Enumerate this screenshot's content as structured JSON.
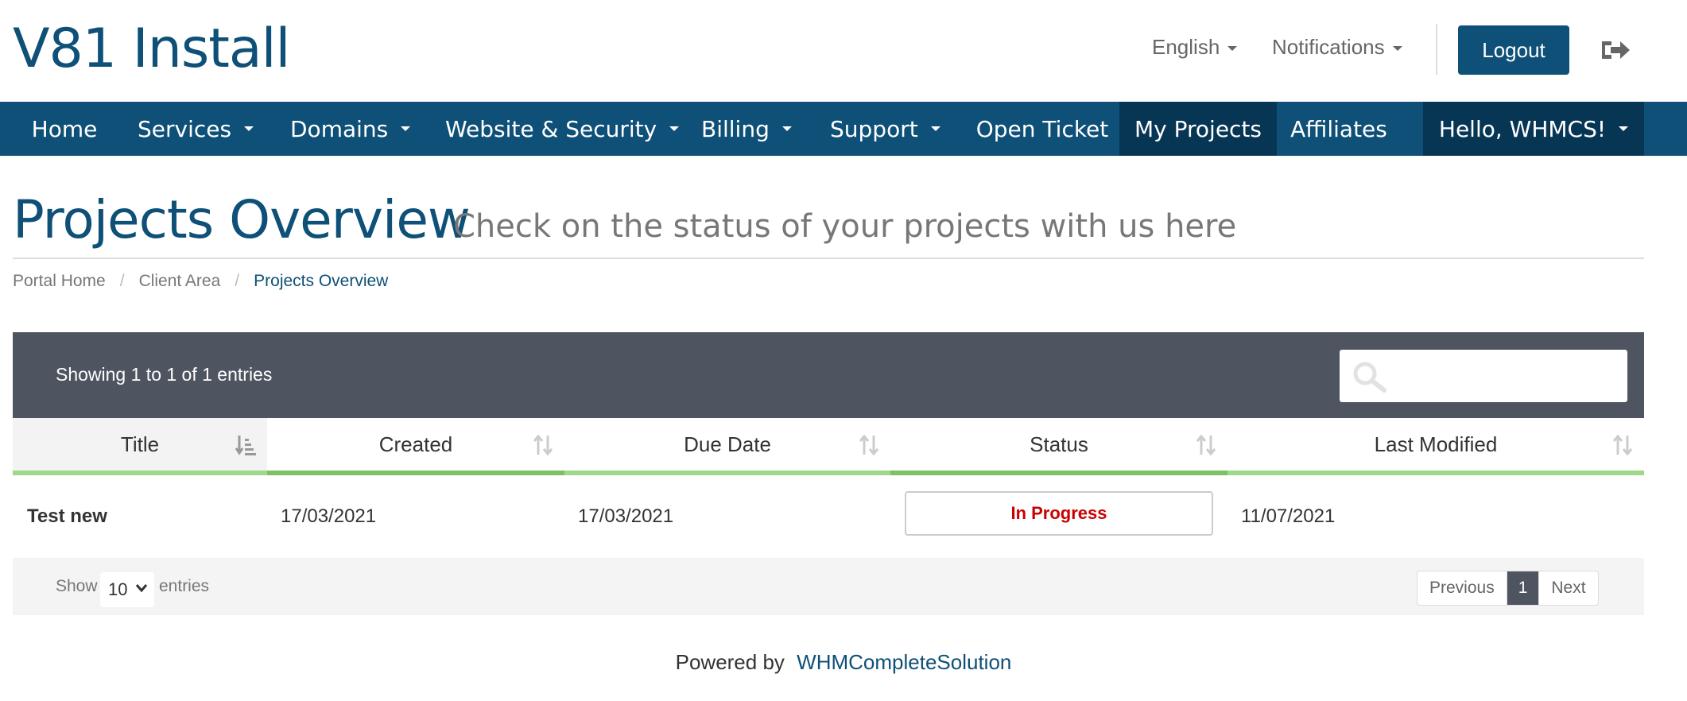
{
  "brand": "V81 Install",
  "header": {
    "language_label": "English",
    "notifications_label": "Notifications",
    "logout_label": "Logout"
  },
  "nav": {
    "items": [
      {
        "label": "Home"
      },
      {
        "label": "Services"
      },
      {
        "label": "Domains"
      },
      {
        "label": "Website & Security"
      },
      {
        "label": "Billing"
      },
      {
        "label": "Support"
      },
      {
        "label": "Open Ticket"
      },
      {
        "label": "My Projects"
      },
      {
        "label": "Affiliates"
      }
    ],
    "user_label": "Hello, WHMCS!"
  },
  "page": {
    "title": "Projects Overview",
    "subtitle": "Check on the status of your projects with us here"
  },
  "breadcrumb": {
    "items": [
      "Portal Home",
      "Client Area",
      "Projects Overview"
    ],
    "separator": "/"
  },
  "table": {
    "showing_text": "Showing 1 to 1 of 1 entries",
    "search_placeholder": "",
    "columns": [
      "Title",
      "Created",
      "Due Date",
      "Status",
      "Last Modified"
    ],
    "rows": [
      {
        "title": "Test new",
        "created": "17/03/2021",
        "due_date": "17/03/2021",
        "status": "In Progress",
        "last_modified": "11/07/2021"
      }
    ],
    "footer": {
      "show_label": "Show",
      "page_size": "10",
      "entries_label": "entries",
      "previous_label": "Previous",
      "current_page": "1",
      "next_label": "Next"
    }
  },
  "footer": {
    "powered_by": "Powered by",
    "link_text": "WHMCompleteSolution"
  },
  "colors": {
    "brand": "#0e5077",
    "nav_active": "#073655",
    "table_header_bg": "#4f5560",
    "sort_bar": "#9fd88b",
    "status_in_progress": "#cc0000"
  },
  "icons": {
    "signout": "sign-out-icon",
    "search": "search-icon",
    "sort": "sort-icon",
    "sort_active": "sort-amount-icon"
  }
}
